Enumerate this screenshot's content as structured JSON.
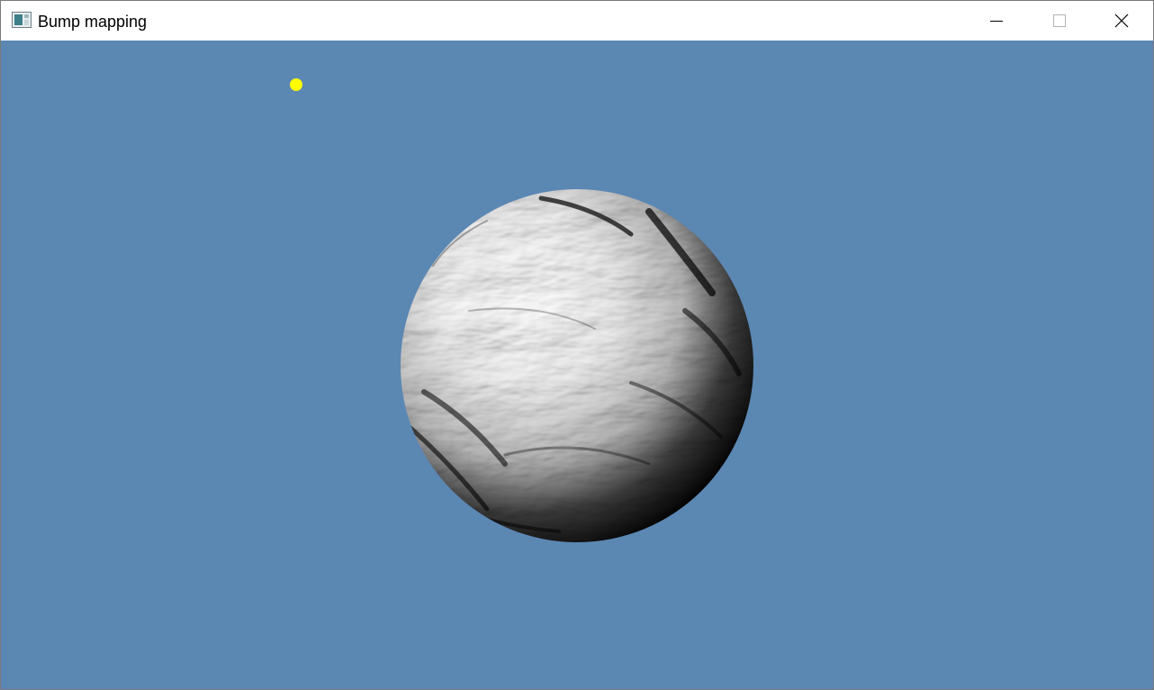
{
  "window": {
    "title": "Bump mapping"
  },
  "icons": {
    "app": "app-window-icon",
    "minimize": "minimize-icon",
    "maximize": "maximize-icon",
    "close": "close-icon"
  },
  "scene": {
    "background_color": "#5b87b3",
    "light_color": "#ffff00",
    "sphere_highlight_color": "#ffffff",
    "sphere_shadow_color": "#000000"
  }
}
